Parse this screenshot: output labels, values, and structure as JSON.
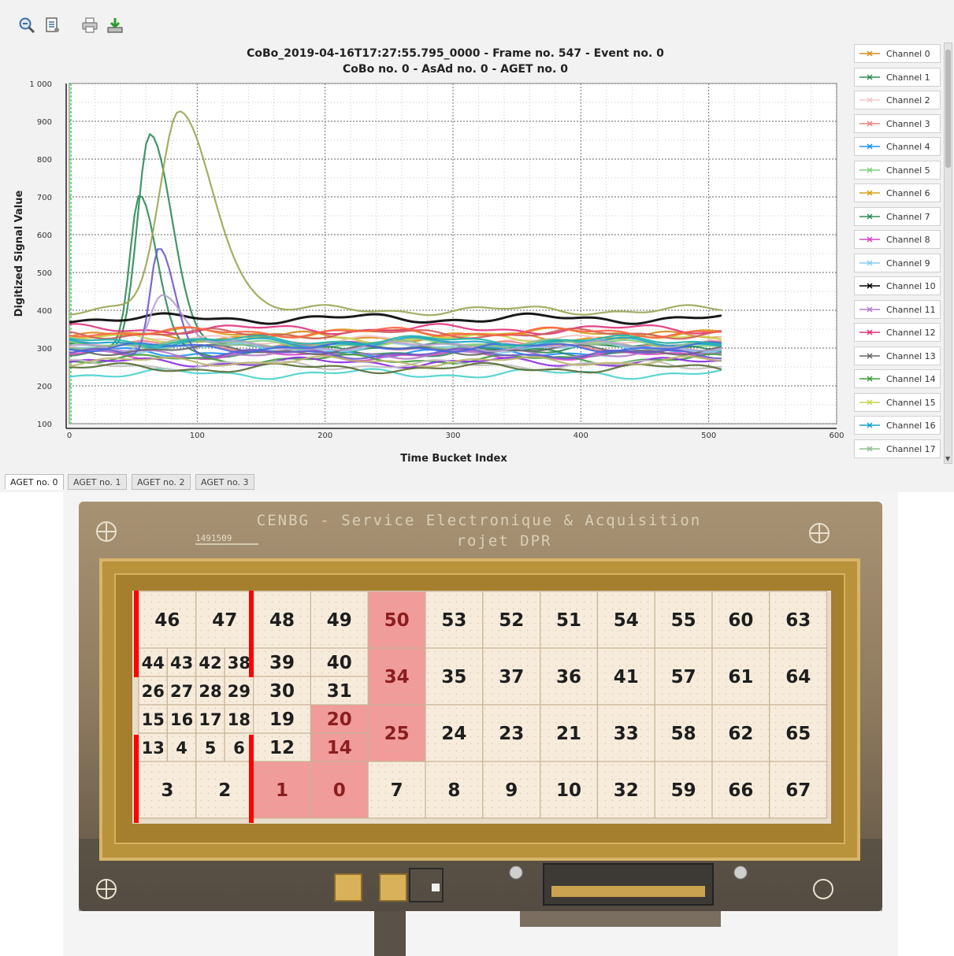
{
  "toolbar": {
    "icons": [
      "zoom-out-icon",
      "properties-icon",
      "print-icon",
      "save-icon"
    ]
  },
  "chart_data": {
    "type": "line",
    "title": "CoBo_2019-04-16T17:27:55.795_0000 - Frame no. 547 - Event no. 0",
    "subtitle": "CoBo no. 0 - AsAd no. 0 - AGET no. 0",
    "xlabel": "Time Bucket Index",
    "ylabel": "Digitized Signal Value",
    "xlim": [
      0,
      600
    ],
    "ylim": [
      100,
      1000
    ],
    "x_ticks": [
      0,
      100,
      200,
      300,
      400,
      500,
      600
    ],
    "y_ticks": [
      100,
      200,
      300,
      400,
      500,
      600,
      700,
      800,
      900,
      1000
    ],
    "x_tick_labels": [
      "0",
      "100",
      "200",
      "300",
      "400",
      "500",
      "600"
    ],
    "y_tick_labels": [
      "100",
      "200",
      "300",
      "400",
      "500",
      "600",
      "700",
      "800",
      "900",
      "1 000"
    ],
    "grid": true,
    "legend": "right",
    "x_range": [
      0,
      511
    ],
    "series": [
      {
        "name": "Channel 0",
        "color": "#d98c1a",
        "baseline": 330
      },
      {
        "name": "Channel 1",
        "color": "#2e8b57",
        "baseline": 300,
        "peak": {
          "x": 63,
          "value": 870,
          "width": 13
        }
      },
      {
        "name": "Channel 2",
        "color": "#f4c7c7",
        "baseline": 320
      },
      {
        "name": "Channel 3",
        "color": "#f08080",
        "baseline": 305
      },
      {
        "name": "Channel 4",
        "color": "#1e90ff",
        "baseline": 290
      },
      {
        "name": "Channel 5",
        "color": "#7ccd7c",
        "baseline": 310
      },
      {
        "name": "Channel 6",
        "color": "#d4a017",
        "baseline": 340
      },
      {
        "name": "Channel 7",
        "color": "#2e8b57",
        "baseline": 290,
        "peak": {
          "x": 55,
          "value": 700,
          "width": 10
        }
      },
      {
        "name": "Channel 8",
        "color": "#d645c4",
        "baseline": 280
      },
      {
        "name": "Channel 9",
        "color": "#87ceeb",
        "baseline": 300
      },
      {
        "name": "Channel 10",
        "color": "#000000",
        "baseline": 378
      },
      {
        "name": "Channel 11",
        "color": "#b07cc6",
        "baseline": 285
      },
      {
        "name": "Channel 12",
        "color": "#e0307a",
        "baseline": 350
      },
      {
        "name": "Channel 13",
        "color": "#666666",
        "baseline": 295
      },
      {
        "name": "Channel 14",
        "color": "#3c9c3c",
        "baseline": 270
      },
      {
        "name": "Channel 15",
        "color": "#c8d650",
        "baseline": 325
      },
      {
        "name": "Channel 16",
        "color": "#17a2c9",
        "baseline": 315
      },
      {
        "name": "Channel 17",
        "color": "#8fbc8f",
        "baseline": 310
      },
      {
        "color": "#9aa553",
        "baseline": 400,
        "peak": {
          "x": 86,
          "value": 920,
          "width": 20
        }
      },
      {
        "color": "#6a5acd",
        "baseline": 285,
        "peak": {
          "x": 70,
          "value": 570,
          "width": 9
        }
      },
      {
        "color": "#b5a0d0",
        "baseline": 305,
        "peak": {
          "x": 72,
          "value": 440,
          "width": 12
        }
      },
      {
        "color": "#48d1cc",
        "baseline": 232
      },
      {
        "color": "#8b2be2",
        "baseline": 262
      },
      {
        "color": "#c0c0c0",
        "baseline": 255
      },
      {
        "color": "#cd5c5c",
        "baseline": 338
      },
      {
        "color": "#4169e1",
        "baseline": 302
      },
      {
        "color": "#556b2f",
        "baseline": 247
      },
      {
        "color": "#20b2aa",
        "baseline": 320
      },
      {
        "color": "#ff6347",
        "baseline": 342
      },
      {
        "color": "#bdb76b",
        "baseline": 265
      }
    ]
  },
  "tabs": [
    "AGET no. 0",
    "AGET no. 1",
    "AGET no. 2",
    "AGET no. 3"
  ],
  "board": {
    "silkscreen_line1": "CENBG - Service Electronique & Acquisition",
    "silkscreen_line2": "rojet DPR",
    "serial": "1491509",
    "highlight_color": "#f19b9b",
    "pad_color": "#f7ecdc",
    "pads": [
      {
        "label": "46",
        "col": 0,
        "row": 0,
        "w": 1,
        "h": 2
      },
      {
        "label": "47",
        "col": 1,
        "row": 0,
        "w": 1,
        "h": 2
      },
      {
        "label": "48",
        "col": 2,
        "row": 0,
        "w": 1,
        "h": 2
      },
      {
        "label": "49",
        "col": 3,
        "row": 0,
        "w": 1,
        "h": 2
      },
      {
        "label": "50",
        "col": 4,
        "row": 0,
        "w": 1,
        "h": 2,
        "hl": true
      },
      {
        "label": "53",
        "col": 5,
        "row": 0,
        "w": 1,
        "h": 2
      },
      {
        "label": "52",
        "col": 6,
        "row": 0,
        "w": 1,
        "h": 2
      },
      {
        "label": "51",
        "col": 7,
        "row": 0,
        "w": 1,
        "h": 2
      },
      {
        "label": "54",
        "col": 8,
        "row": 0,
        "w": 1,
        "h": 2
      },
      {
        "label": "55",
        "col": 9,
        "row": 0,
        "w": 1,
        "h": 2
      },
      {
        "label": "60",
        "col": 10,
        "row": 0,
        "w": 1,
        "h": 2
      },
      {
        "label": "63",
        "col": 11,
        "row": 0,
        "w": 1,
        "h": 2
      },
      {
        "label": "44",
        "col": 0,
        "row": 2,
        "w": 0.5,
        "h": 1
      },
      {
        "label": "43",
        "col": 0.5,
        "row": 2,
        "w": 0.5,
        "h": 1
      },
      {
        "label": "42",
        "col": 1,
        "row": 2,
        "w": 0.5,
        "h": 1
      },
      {
        "label": "38",
        "col": 1.5,
        "row": 2,
        "w": 0.5,
        "h": 1
      },
      {
        "label": "39",
        "col": 2,
        "row": 2,
        "w": 1,
        "h": 1
      },
      {
        "label": "40",
        "col": 3,
        "row": 2,
        "w": 1,
        "h": 1
      },
      {
        "label": "34",
        "col": 4,
        "row": 2,
        "w": 1,
        "h": 2,
        "hl": true
      },
      {
        "label": "35",
        "col": 5,
        "row": 2,
        "w": 1,
        "h": 2
      },
      {
        "label": "37",
        "col": 6,
        "row": 2,
        "w": 1,
        "h": 2
      },
      {
        "label": "36",
        "col": 7,
        "row": 2,
        "w": 1,
        "h": 2
      },
      {
        "label": "41",
        "col": 8,
        "row": 2,
        "w": 1,
        "h": 2
      },
      {
        "label": "57",
        "col": 9,
        "row": 2,
        "w": 1,
        "h": 2
      },
      {
        "label": "61",
        "col": 10,
        "row": 2,
        "w": 1,
        "h": 2
      },
      {
        "label": "64",
        "col": 11,
        "row": 2,
        "w": 1,
        "h": 2
      },
      {
        "label": "26",
        "col": 0,
        "row": 3,
        "w": 0.5,
        "h": 1
      },
      {
        "label": "27",
        "col": 0.5,
        "row": 3,
        "w": 0.5,
        "h": 1
      },
      {
        "label": "28",
        "col": 1,
        "row": 3,
        "w": 0.5,
        "h": 1
      },
      {
        "label": "29",
        "col": 1.5,
        "row": 3,
        "w": 0.5,
        "h": 1
      },
      {
        "label": "30",
        "col": 2,
        "row": 3,
        "w": 1,
        "h": 1
      },
      {
        "label": "31",
        "col": 3,
        "row": 3,
        "w": 1,
        "h": 1
      },
      {
        "label": "15",
        "col": 0,
        "row": 4,
        "w": 0.5,
        "h": 1
      },
      {
        "label": "16",
        "col": 0.5,
        "row": 4,
        "w": 0.5,
        "h": 1
      },
      {
        "label": "17",
        "col": 1,
        "row": 4,
        "w": 0.5,
        "h": 1
      },
      {
        "label": "18",
        "col": 1.5,
        "row": 4,
        "w": 0.5,
        "h": 1
      },
      {
        "label": "19",
        "col": 2,
        "row": 4,
        "w": 1,
        "h": 1
      },
      {
        "label": "20",
        "col": 3,
        "row": 4,
        "w": 1,
        "h": 1,
        "hl": true
      },
      {
        "label": "25",
        "col": 4,
        "row": 4,
        "w": 1,
        "h": 2,
        "hl": true
      },
      {
        "label": "24",
        "col": 5,
        "row": 4,
        "w": 1,
        "h": 2
      },
      {
        "label": "23",
        "col": 6,
        "row": 4,
        "w": 1,
        "h": 2
      },
      {
        "label": "21",
        "col": 7,
        "row": 4,
        "w": 1,
        "h": 2
      },
      {
        "label": "33",
        "col": 8,
        "row": 4,
        "w": 1,
        "h": 2
      },
      {
        "label": "58",
        "col": 9,
        "row": 4,
        "w": 1,
        "h": 2
      },
      {
        "label": "62",
        "col": 10,
        "row": 4,
        "w": 1,
        "h": 2
      },
      {
        "label": "65",
        "col": 11,
        "row": 4,
        "w": 1,
        "h": 2
      },
      {
        "label": "13",
        "col": 0,
        "row": 5,
        "w": 0.5,
        "h": 1
      },
      {
        "label": "4",
        "col": 0.5,
        "row": 5,
        "w": 0.5,
        "h": 1
      },
      {
        "label": "5",
        "col": 1,
        "row": 5,
        "w": 0.5,
        "h": 1
      },
      {
        "label": "6",
        "col": 1.5,
        "row": 5,
        "w": 0.5,
        "h": 1
      },
      {
        "label": "12",
        "col": 2,
        "row": 5,
        "w": 1,
        "h": 1
      },
      {
        "label": "14",
        "col": 3,
        "row": 5,
        "w": 1,
        "h": 1,
        "hl": true
      },
      {
        "label": "3",
        "col": 0,
        "row": 6,
        "w": 1,
        "h": 2
      },
      {
        "label": "2",
        "col": 1,
        "row": 6,
        "w": 1,
        "h": 2
      },
      {
        "label": "1",
        "col": 2,
        "row": 6,
        "w": 1,
        "h": 2,
        "hl": true
      },
      {
        "label": "0",
        "col": 3,
        "row": 6,
        "w": 1,
        "h": 2,
        "hl": true
      },
      {
        "label": "7",
        "col": 4,
        "row": 6,
        "w": 1,
        "h": 2
      },
      {
        "label": "8",
        "col": 5,
        "row": 6,
        "w": 1,
        "h": 2
      },
      {
        "label": "9",
        "col": 6,
        "row": 6,
        "w": 1,
        "h": 2
      },
      {
        "label": "10",
        "col": 7,
        "row": 6,
        "w": 1,
        "h": 2
      },
      {
        "label": "32",
        "col": 8,
        "row": 6,
        "w": 1,
        "h": 2
      },
      {
        "label": "59",
        "col": 9,
        "row": 6,
        "w": 1,
        "h": 2
      },
      {
        "label": "66",
        "col": 10,
        "row": 6,
        "w": 1,
        "h": 2
      },
      {
        "label": "67",
        "col": 11,
        "row": 6,
        "w": 1,
        "h": 2
      }
    ]
  }
}
